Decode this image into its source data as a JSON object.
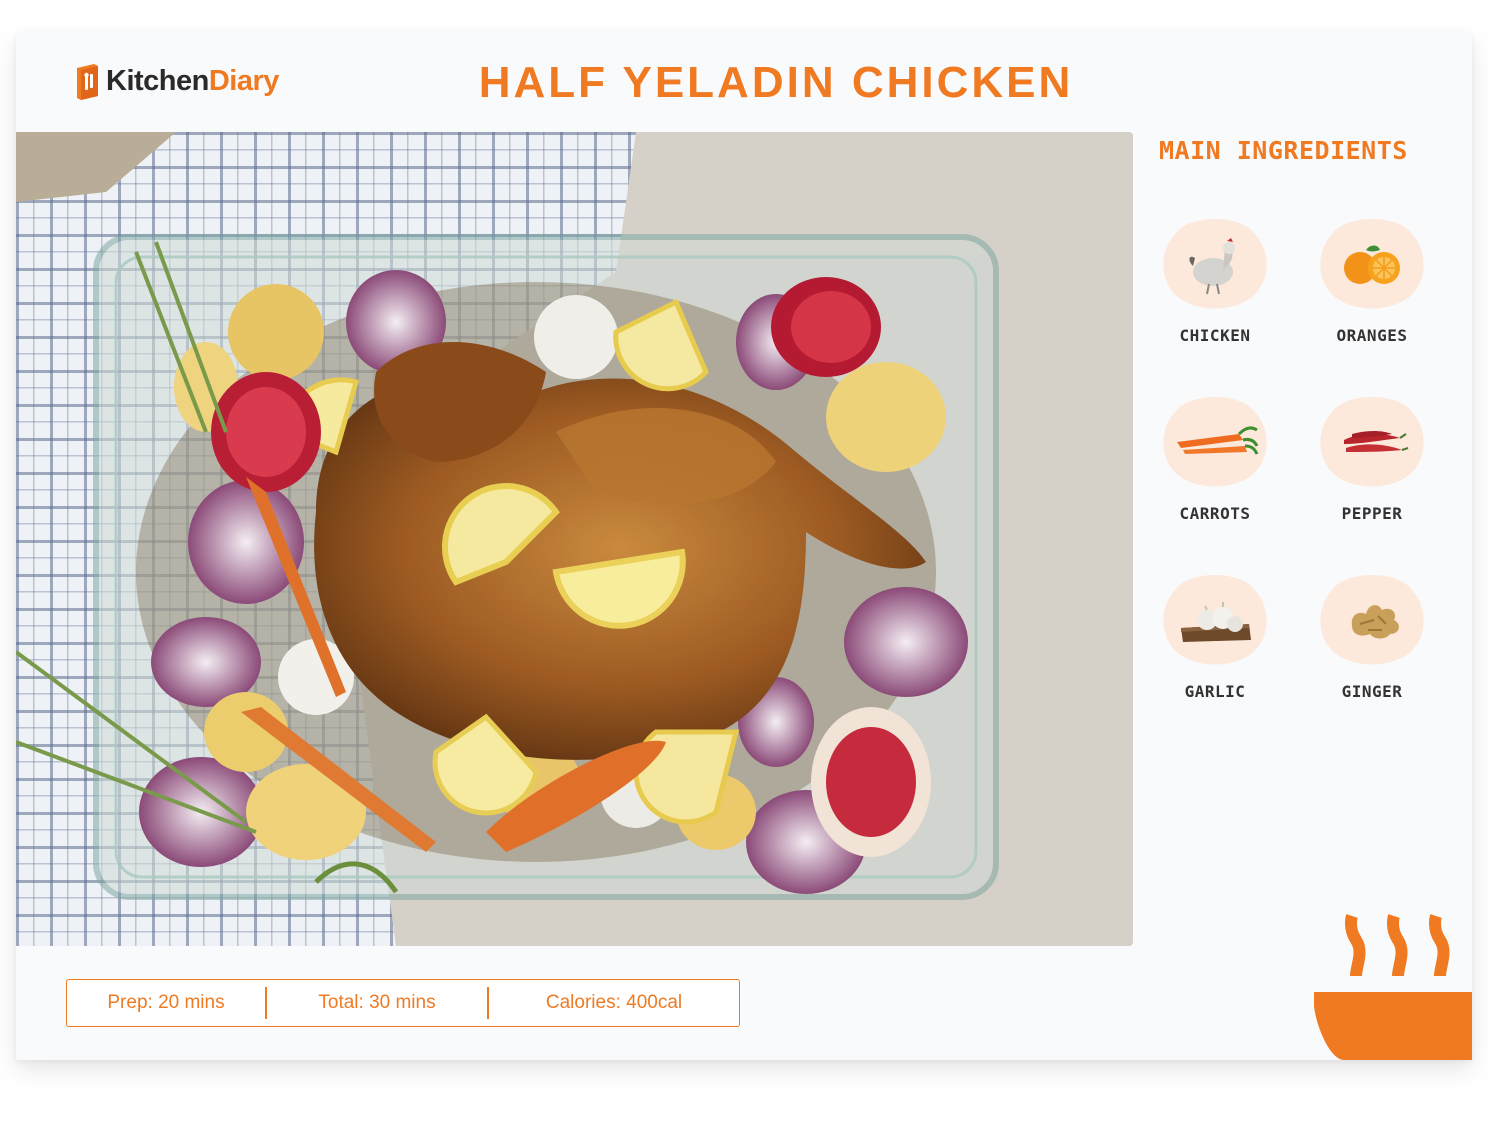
{
  "brand": {
    "name_part1": "Kitchen",
    "name_part2": "Diary"
  },
  "recipe": {
    "title": "HALF YELADIN CHICKEN"
  },
  "ingredients": {
    "heading": "MAIN INGREDIENTS",
    "items": [
      {
        "label": "CHICKEN",
        "icon": "chicken-icon"
      },
      {
        "label": "ORANGES",
        "icon": "orange-icon"
      },
      {
        "label": "CARROTS",
        "icon": "carrot-icon"
      },
      {
        "label": "PEPPER",
        "icon": "chili-pepper-icon"
      },
      {
        "label": "GARLIC",
        "icon": "garlic-icon"
      },
      {
        "label": "GINGER",
        "icon": "ginger-icon"
      }
    ]
  },
  "stats": {
    "prep": "Prep: 20 mins",
    "total": "Total: 30 mins",
    "calories": "Calories: 400cal"
  },
  "colors": {
    "accent": "#f07a22",
    "badge": "#fde9dc",
    "background": "#f9fafc"
  }
}
